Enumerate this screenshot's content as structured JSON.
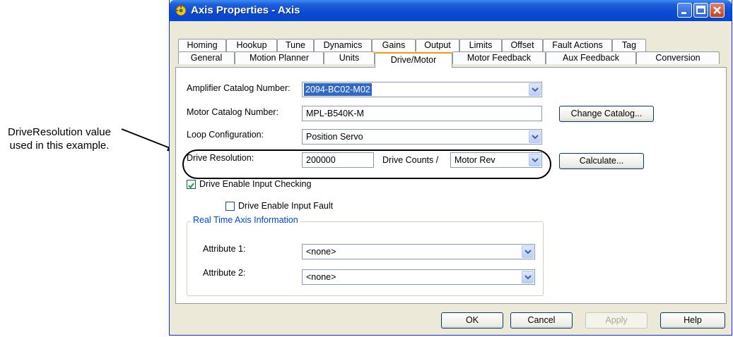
{
  "annotation": {
    "line1": "DriveResolution value",
    "line2": "used in this example."
  },
  "window": {
    "title": "Axis Properties - Axis"
  },
  "tabs_row1": [
    "Homing",
    "Hookup",
    "Tune",
    "Dynamics",
    "Gains",
    "Output",
    "Limits",
    "Offset",
    "Fault Actions",
    "Tag"
  ],
  "tabs_row2": [
    "General",
    "Motion Planner",
    "Units",
    "Drive/Motor",
    "Motor Feedback",
    "Aux Feedback",
    "Conversion"
  ],
  "active_tab": "Drive/Motor",
  "form": {
    "amplifier_label": "Amplifier Catalog Number:",
    "amplifier_value": "2094-BC02-M02",
    "motor_label": "Motor Catalog Number:",
    "motor_value": "MPL-B540K-M",
    "change_catalog": "Change Catalog...",
    "loop_label": "Loop Configuration:",
    "loop_value": "Position Servo",
    "resolution_label": "Drive Resolution:",
    "resolution_value": "200000",
    "counts_label": "Drive Counts /",
    "counts_unit": "Motor Rev",
    "calculate": "Calculate...",
    "enable_check_label": "Drive Enable Input Checking",
    "enable_check_checked": true,
    "enable_fault_label": "Drive Enable Input Fault",
    "enable_fault_checked": false,
    "group_title": "Real Time Axis Information",
    "attr1_label": "Attribute 1:",
    "attr1_value": "<none>",
    "attr2_label": "Attribute 2:",
    "attr2_value": "<none>"
  },
  "buttons": {
    "ok": "OK",
    "cancel": "Cancel",
    "apply": "Apply",
    "help": "Help"
  },
  "colors": {
    "titlebar": "#0a4ad4",
    "selection": "#316ac5",
    "dialog_bg": "#ece9d8"
  }
}
